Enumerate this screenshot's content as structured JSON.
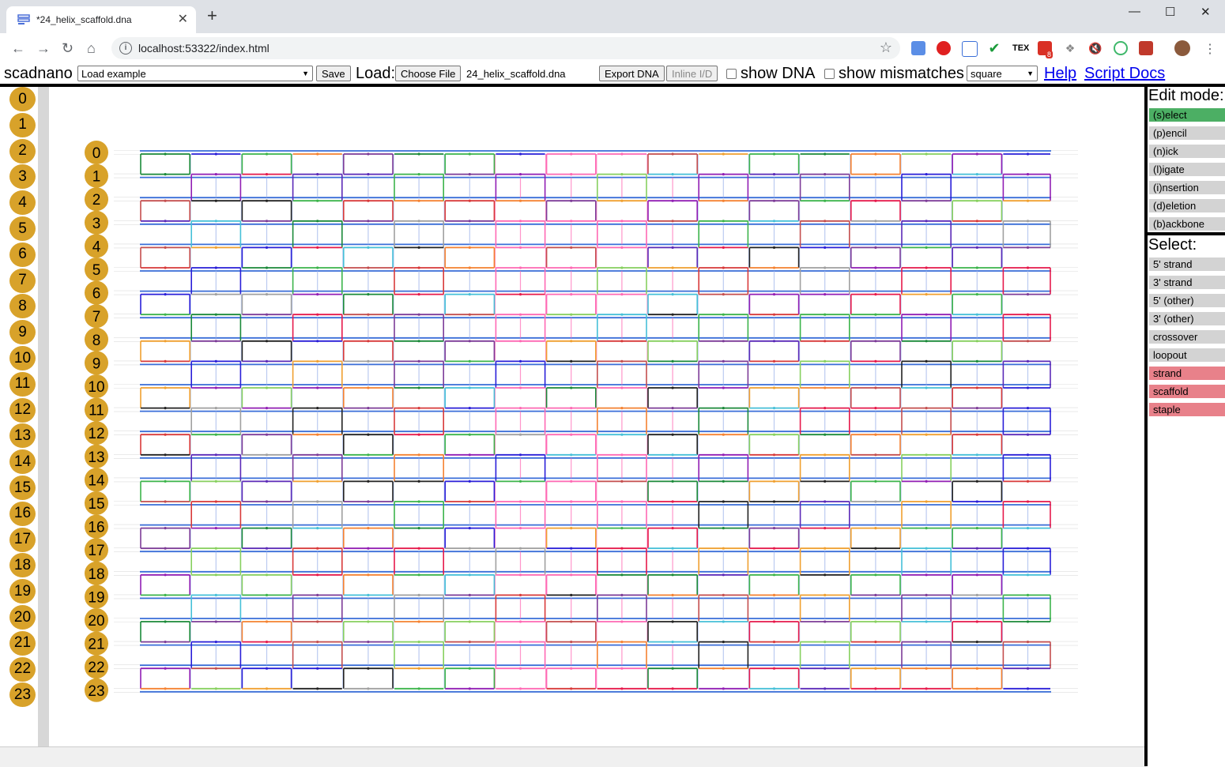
{
  "browser": {
    "tab_title": "*24_helix_scaffold.dna",
    "url": "localhost:53322/index.html",
    "notification_badge": "8"
  },
  "toolbar": {
    "app_name": "scadnano",
    "load_example_label": "Load example",
    "save_label": "Save",
    "load_label": "Load:",
    "choose_file_label": "Choose File",
    "file_name": "24_helix_scaffold.dna",
    "export_dna_label": "Export DNA",
    "inline_id_label": "Inline I/D",
    "show_dna_label": "show DNA",
    "show_mismatches_label": "show mismatches",
    "grid_value": "square",
    "help_label": "Help",
    "script_docs_label": "Script Docs"
  },
  "side_helices": [
    "0",
    "1",
    "2",
    "3",
    "4",
    "5",
    "6",
    "7",
    "8",
    "9",
    "10",
    "11",
    "12",
    "13",
    "14",
    "15",
    "16",
    "17",
    "18",
    "19",
    "20",
    "21",
    "22",
    "23"
  ],
  "main_helices": [
    "0",
    "1",
    "2",
    "3",
    "4",
    "5",
    "6",
    "7",
    "8",
    "9",
    "10",
    "11",
    "12",
    "13",
    "14",
    "15",
    "16",
    "17",
    "18",
    "19",
    "20",
    "21",
    "22",
    "23"
  ],
  "edit_mode": {
    "title": "Edit mode:",
    "items": [
      "(s)elect",
      "(p)encil",
      "(n)ick",
      "(l)igate",
      "(i)nsertion",
      "(d)eletion",
      "(b)ackbone"
    ],
    "active": "(s)elect"
  },
  "select_mode": {
    "title": "Select:",
    "items": [
      "5' strand",
      "3' strand",
      "5' (other)",
      "3' (other)",
      "crossover",
      "loopout",
      "strand",
      "scaffold",
      "staple"
    ],
    "selected": [
      "strand",
      "scaffold",
      "staple"
    ]
  },
  "colors": {
    "helix_circle": "#d8a22a",
    "scaffold": "#3a6ed8",
    "scaffold_crossover": "#ff69b4",
    "staple_palette": [
      "#e6194b",
      "#3cb44b",
      "#911eb4",
      "#f58231",
      "#46c0d8",
      "#222222",
      "#7d3c98",
      "#1b8a3a",
      "#2a1fd8",
      "#f0a030",
      "#87d05f",
      "#c44e4e",
      "#a0a0a0",
      "#d83a3a",
      "#5b2ab8"
    ],
    "active_mode": "#4caf64",
    "selected_filter": "#e8818a"
  }
}
